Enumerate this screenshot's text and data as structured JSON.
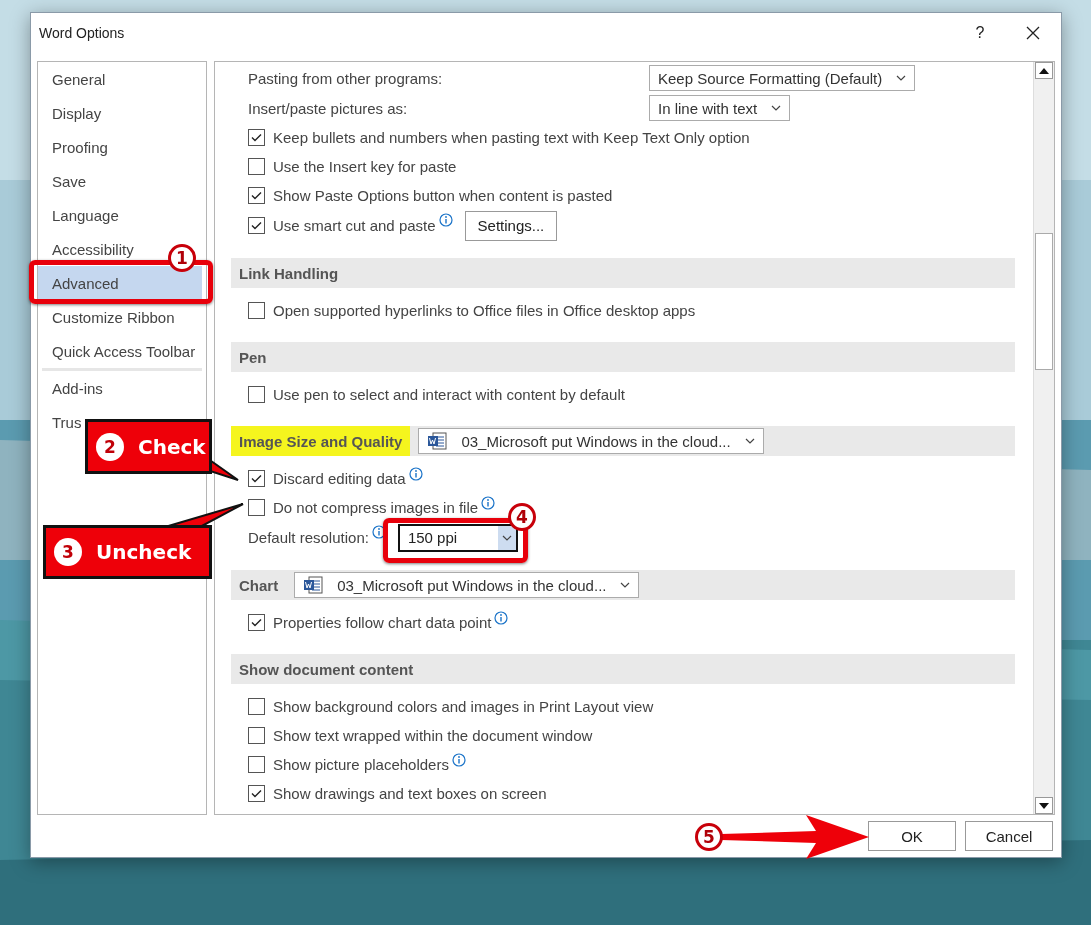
{
  "window": {
    "title": "Word Options",
    "help": "?"
  },
  "sidebar": {
    "items": [
      {
        "label": "General",
        "selected": false,
        "separator_before": false
      },
      {
        "label": "Display",
        "selected": false,
        "separator_before": false
      },
      {
        "label": "Proofing",
        "selected": false,
        "separator_before": false
      },
      {
        "label": "Save",
        "selected": false,
        "separator_before": false
      },
      {
        "label": "Language",
        "selected": false,
        "separator_before": false
      },
      {
        "label": "Accessibility",
        "selected": false,
        "separator_before": false
      },
      {
        "label": "Advanced",
        "selected": true,
        "separator_before": false
      },
      {
        "label": "Customize Ribbon",
        "selected": false,
        "separator_before": false
      },
      {
        "label": "Quick Access Toolbar",
        "selected": false,
        "separator_before": false
      },
      {
        "label": "Add-ins",
        "selected": false,
        "separator_before": true
      },
      {
        "label": "Trus",
        "selected": false,
        "separator_before": false
      }
    ]
  },
  "main": {
    "items": [
      {
        "kind": "select",
        "label": "Pasting from other programs:",
        "value": "Keep Source Formatting (Default)"
      },
      {
        "kind": "select",
        "label": "Insert/paste pictures as:",
        "value": "In line with text"
      },
      {
        "kind": "check",
        "label": "Keep bullets and numbers when pasting text with Keep Text Only option",
        "checked": true,
        "info": false
      },
      {
        "kind": "check",
        "label": "Use the Insert key for paste",
        "checked": false,
        "info": false
      },
      {
        "kind": "check",
        "label": "Show Paste Options button when content is pasted",
        "checked": true,
        "info": false
      },
      {
        "kind": "check",
        "label": "Use smart cut and paste",
        "checked": true,
        "info": true,
        "button": "Settings..."
      },
      {
        "kind": "section",
        "title": "Link Handling",
        "highlighted": false
      },
      {
        "kind": "check",
        "label": "Open supported hyperlinks to Office files in Office desktop apps",
        "checked": false,
        "info": false
      },
      {
        "kind": "section",
        "title": "Pen",
        "highlighted": false
      },
      {
        "kind": "check",
        "label": "Use pen to select and interact with content by default",
        "checked": false,
        "info": false
      },
      {
        "kind": "section",
        "title": "Image Size and Quality",
        "highlighted": true,
        "file": "03_Microsoft put Windows in the cloud..."
      },
      {
        "kind": "check",
        "label": "Discard editing data",
        "checked": true,
        "info": true
      },
      {
        "kind": "check",
        "label": "Do not compress images in file",
        "checked": false,
        "info": true
      },
      {
        "kind": "resolution",
        "label": "Default resolution:",
        "value": "150 ppi",
        "info": true
      },
      {
        "kind": "section",
        "title": "Chart",
        "highlighted": false,
        "file": "03_Microsoft put Windows in the cloud..."
      },
      {
        "kind": "check",
        "label": "Properties follow chart data point",
        "checked": true,
        "info": true
      },
      {
        "kind": "section",
        "title": "Show document content",
        "highlighted": false
      },
      {
        "kind": "check",
        "label": "Show background colors and images in Print Layout view",
        "checked": false,
        "info": false
      },
      {
        "kind": "check",
        "label": "Show text wrapped within the document window",
        "checked": false,
        "info": false
      },
      {
        "kind": "check",
        "label": "Show picture placeholders",
        "checked": false,
        "info": true
      },
      {
        "kind": "check",
        "label": "Show drawings and text boxes on screen",
        "checked": true,
        "info": false
      }
    ]
  },
  "buttons": [
    "OK",
    "Cancel"
  ],
  "annotations": [
    {
      "kind": "frame",
      "number": "1"
    },
    {
      "kind": "callout",
      "number": "2",
      "text": "Check"
    },
    {
      "kind": "callout",
      "number": "3",
      "text": "Uncheck"
    },
    {
      "kind": "frame",
      "number": "4"
    },
    {
      "kind": "arrow",
      "number": "5"
    }
  ]
}
